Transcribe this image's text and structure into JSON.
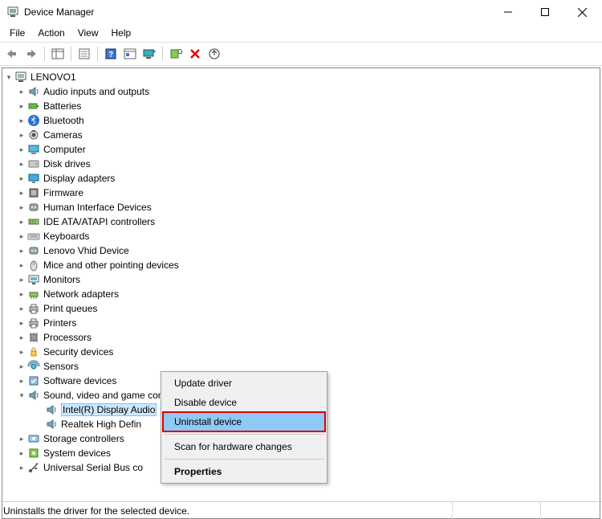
{
  "window": {
    "title": "Device Manager"
  },
  "menubar": {
    "items": [
      "File",
      "Action",
      "View",
      "Help"
    ]
  },
  "tree": {
    "root": "LENOVO1",
    "categories": [
      {
        "label": "Audio inputs and outputs",
        "icon": "speaker"
      },
      {
        "label": "Batteries",
        "icon": "battery"
      },
      {
        "label": "Bluetooth",
        "icon": "bluetooth"
      },
      {
        "label": "Cameras",
        "icon": "camera"
      },
      {
        "label": "Computer",
        "icon": "computer"
      },
      {
        "label": "Disk drives",
        "icon": "disk"
      },
      {
        "label": "Display adapters",
        "icon": "display"
      },
      {
        "label": "Firmware",
        "icon": "firmware"
      },
      {
        "label": "Human Interface Devices",
        "icon": "hid"
      },
      {
        "label": "IDE ATA/ATAPI controllers",
        "icon": "ide"
      },
      {
        "label": "Keyboards",
        "icon": "keyboard"
      },
      {
        "label": "Lenovo Vhid Device",
        "icon": "hid"
      },
      {
        "label": "Mice and other pointing devices",
        "icon": "mouse"
      },
      {
        "label": "Monitors",
        "icon": "monitor"
      },
      {
        "label": "Network adapters",
        "icon": "network"
      },
      {
        "label": "Print queues",
        "icon": "printer"
      },
      {
        "label": "Printers",
        "icon": "printer"
      },
      {
        "label": "Processors",
        "icon": "cpu"
      },
      {
        "label": "Security devices",
        "icon": "security"
      },
      {
        "label": "Sensors",
        "icon": "sensor"
      },
      {
        "label": "Software devices",
        "icon": "software"
      },
      {
        "label": "Sound, video and game controllers",
        "icon": "sound",
        "expanded": true,
        "children": [
          {
            "label": "Intel(R) Display Audio",
            "icon": "sound",
            "selected": true
          },
          {
            "label": "Realtek High Definition Audio",
            "icon": "sound",
            "truncated": "Realtek High Defin"
          }
        ]
      },
      {
        "label": "Storage controllers",
        "icon": "storage"
      },
      {
        "label": "System devices",
        "icon": "system"
      },
      {
        "label": "Universal Serial Bus controllers",
        "icon": "usb",
        "truncated": "Universal Serial Bus co"
      }
    ]
  },
  "context_menu": {
    "items": [
      {
        "label": "Update driver"
      },
      {
        "label": "Disable device"
      },
      {
        "label": "Uninstall device",
        "highlighted": true
      },
      {
        "separator": true
      },
      {
        "label": "Scan for hardware changes"
      },
      {
        "separator": true
      },
      {
        "label": "Properties",
        "bold": true
      }
    ]
  },
  "statusbar": {
    "text": "Uninstalls the driver for the selected device."
  }
}
